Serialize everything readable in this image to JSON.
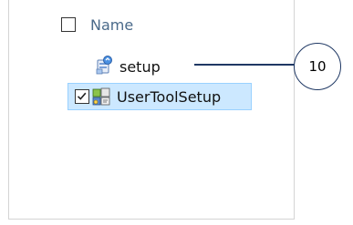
{
  "list": {
    "header": {
      "label": "Name",
      "checked": false
    },
    "items": [
      {
        "label": "setup",
        "icon": "setup-installer-icon",
        "selected": false
      },
      {
        "label": "UserToolSetup",
        "icon": "msi-package-icon",
        "selected": true,
        "checked": true
      }
    ]
  },
  "callout": {
    "number": "10"
  },
  "colors": {
    "selection_bg": "#cce8ff",
    "selection_border": "#99d1ff",
    "callout": "#1f3864"
  }
}
